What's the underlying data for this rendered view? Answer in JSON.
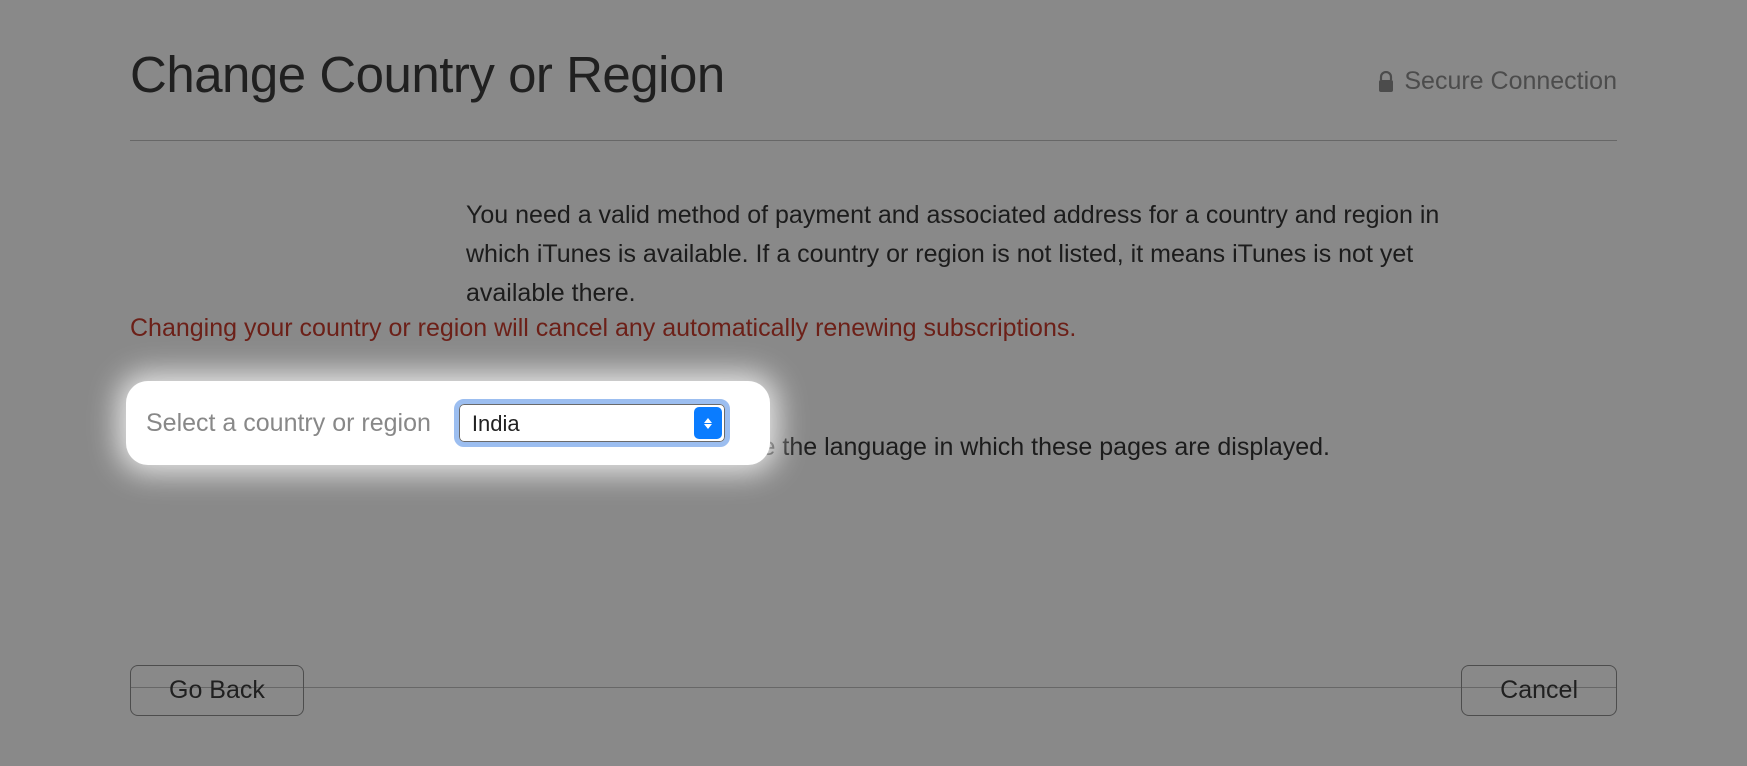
{
  "header": {
    "title": "Change Country or Region",
    "secure_label": "Secure Connection"
  },
  "body": {
    "info": "You need a valid method of payment and associated address for a country and region in which iTunes is available. If a country or region is not listed, it means iTunes is not yet available there.",
    "warning": "Changing your country or region will cancel any automatically renewing subscriptions.",
    "select_label": "Select a country or region",
    "select_value": "India",
    "note": "Note: This may also change the language in which these pages are displayed."
  },
  "footer": {
    "go_back": "Go Back",
    "cancel": "Cancel"
  }
}
